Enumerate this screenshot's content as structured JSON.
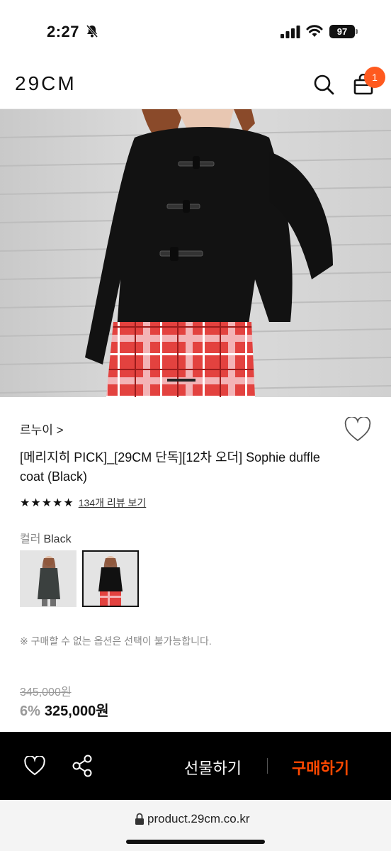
{
  "status_bar": {
    "time": "2:27",
    "battery": "97"
  },
  "header": {
    "logo": "29CM",
    "cart_count": "1"
  },
  "product": {
    "brand": "르누이 >",
    "title": "[메리지히 PICK]_[29CM 단독][12차 오더] Sophie duffle coat (Black)",
    "stars": "★★★★★",
    "review_link": "134개 리뷰 보기",
    "color_prefix": "컬러",
    "color_value": "Black",
    "notice": "※ 구매할 수 없는 옵션은 선택이 불가능합니다.",
    "original_price": "345,000원",
    "discount": "6%",
    "price": "325,000원"
  },
  "bottom_bar": {
    "gift": "선물하기",
    "buy": "구매하기"
  },
  "browser": {
    "url": "product.29cm.co.kr"
  },
  "colors": {
    "accent": "#ff4800",
    "badge": "#ff5a1f"
  },
  "icons": [
    "bell-off-icon",
    "signal-icon",
    "wifi-icon",
    "search-icon",
    "shopping-bag-icon",
    "heart-icon",
    "share-icon",
    "lock-icon"
  ]
}
